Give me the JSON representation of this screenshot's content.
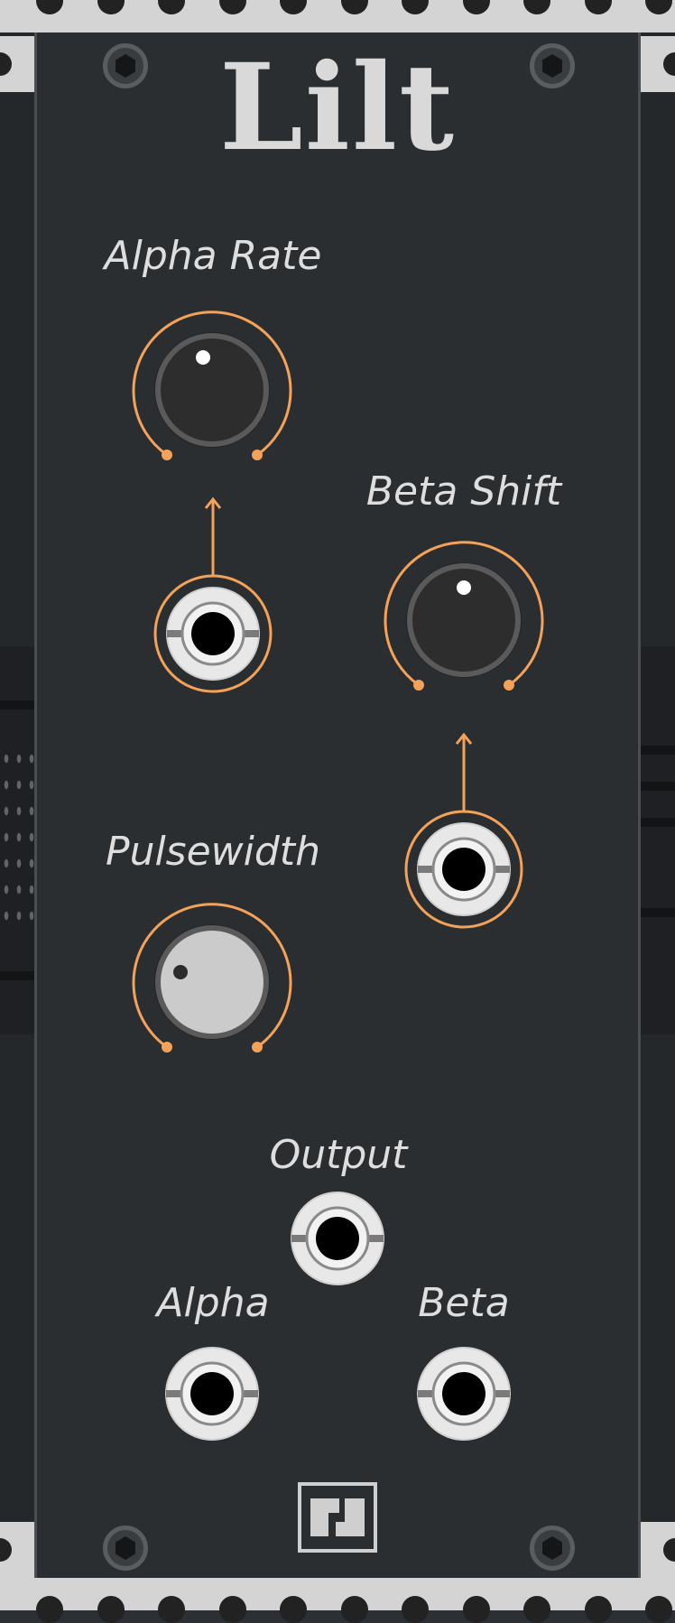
{
  "module": {
    "title": "Lilt"
  },
  "controls": {
    "alpha_rate": {
      "label": "Alpha Rate"
    },
    "beta_shift": {
      "label": "Beta Shift"
    },
    "pulsewidth": {
      "label": "Pulsewidth"
    }
  },
  "outputs": {
    "output": {
      "label": "Output"
    },
    "alpha": {
      "label": "Alpha"
    },
    "beta": {
      "label": "Beta"
    }
  },
  "colors": {
    "accent": "#f4a259",
    "panel": "#2b2e31",
    "title_text": "#d9d9d9",
    "label_text": "#dedede"
  },
  "icons": {
    "logo": "brand-logo-icon",
    "screw": "hex-screw-icon"
  }
}
